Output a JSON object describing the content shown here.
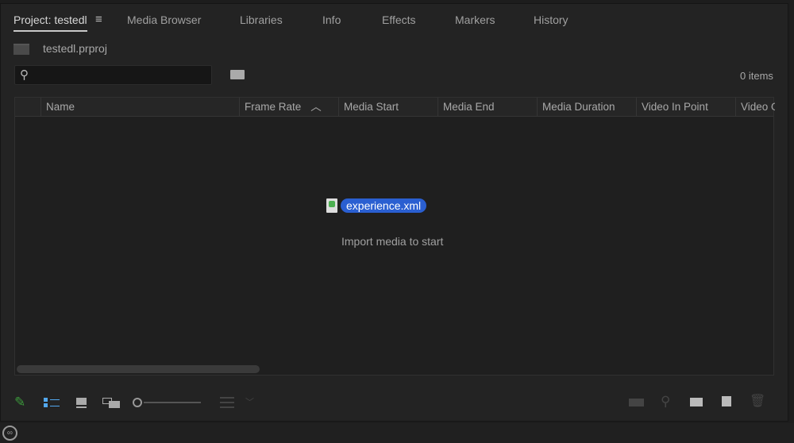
{
  "tabs": [
    {
      "label": "Project: testedl",
      "active": true
    },
    {
      "label": "Media Browser"
    },
    {
      "label": "Libraries"
    },
    {
      "label": "Info"
    },
    {
      "label": "Effects"
    },
    {
      "label": "Markers"
    },
    {
      "label": "History"
    }
  ],
  "project": {
    "filename": "testedl.prproj",
    "item_count": "0 items"
  },
  "search": {
    "placeholder": "",
    "value": ""
  },
  "columns": [
    "Name",
    "Frame Rate",
    "Media Start",
    "Media End",
    "Media Duration",
    "Video In Point",
    "Video Out Point"
  ],
  "sort": {
    "column": "Frame Rate",
    "direction": "ascending"
  },
  "drag_file": {
    "label": "experience.xml",
    "icon": "xml-file-icon"
  },
  "empty_message": "Import media to start",
  "colors": {
    "accent": "#2a5fd1",
    "pencil": "#3c9a3c",
    "list_view": "#52a8ef"
  }
}
